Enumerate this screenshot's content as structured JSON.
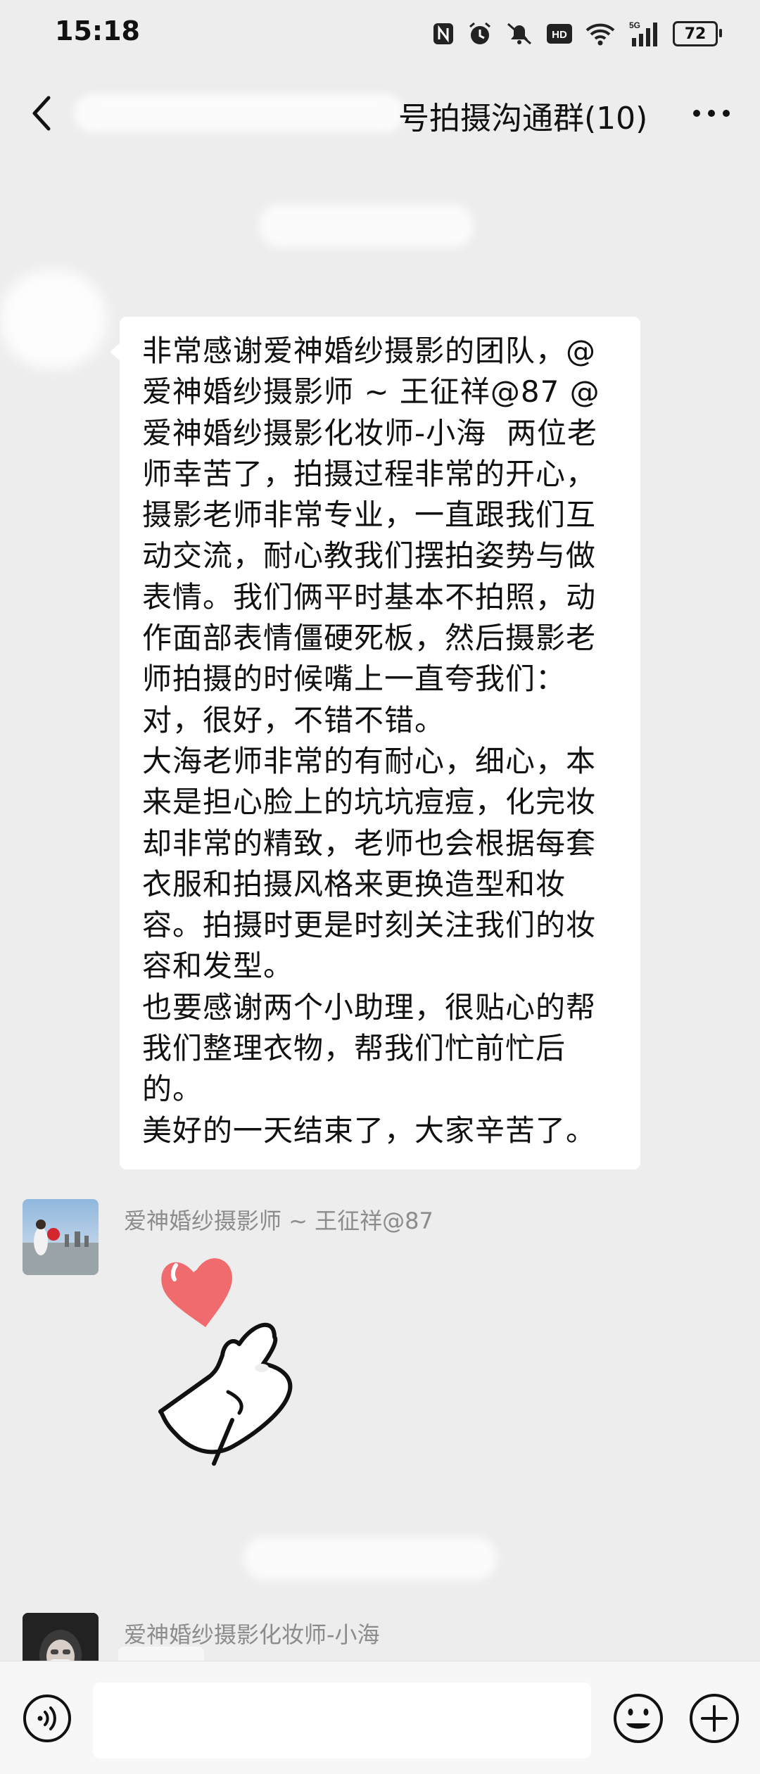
{
  "status_bar": {
    "time": "15:18",
    "network": "5G",
    "battery": "72",
    "icons": [
      "nfc-icon",
      "alarm-icon",
      "mute-icon",
      "hd-icon",
      "wifi-icon",
      "signal-icon",
      "battery-icon"
    ]
  },
  "header": {
    "title": "号拍摄沟通群(10)",
    "back_icon": "chevron-left-icon",
    "more_icon": "more-horizontal-icon"
  },
  "messages": [
    {
      "type": "text",
      "sender": "",
      "text": "非常感谢爱神婚纱摄影的团队，@爱神婚纱摄影师 ~ 王征祥@87 @爱神婚纱摄影化妆师-小海  两位老师幸苦了，拍摄过程非常的开心，摄影老师非常专业，一直跟我们互动交流，耐心教我们摆拍姿势与做表情。我们俩平时基本不拍照，动作面部表情僵硬死板，然后摄影老师拍摄的时候嘴上一直夸我们：对，很好，不错不错。\n大海老师非常的有耐心，细心，本来是担心脸上的坑坑痘痘，化完妆却非常的精致，老师也会根据每套衣服和拍摄风格来更换造型和妆容。拍摄时更是时刻关注我们的妆容和发型。\n也要感谢两个小助理，很贴心的帮我们整理衣物，帮我们忙前忙后的。\n美好的一天结束了，大家辛苦了。"
    },
    {
      "type": "sticker",
      "sender": "爱神婚纱摄影师 ~ 王征祥@87",
      "sticker": "heart-hand-sticker"
    },
    {
      "type": "text",
      "sender": "爱神婚纱摄影化妆师-小海",
      "text": ""
    }
  ],
  "input_bar": {
    "voice_icon": "voice-icon",
    "emoji_icon": "emoji-icon",
    "plus_icon": "plus-icon",
    "value": ""
  }
}
